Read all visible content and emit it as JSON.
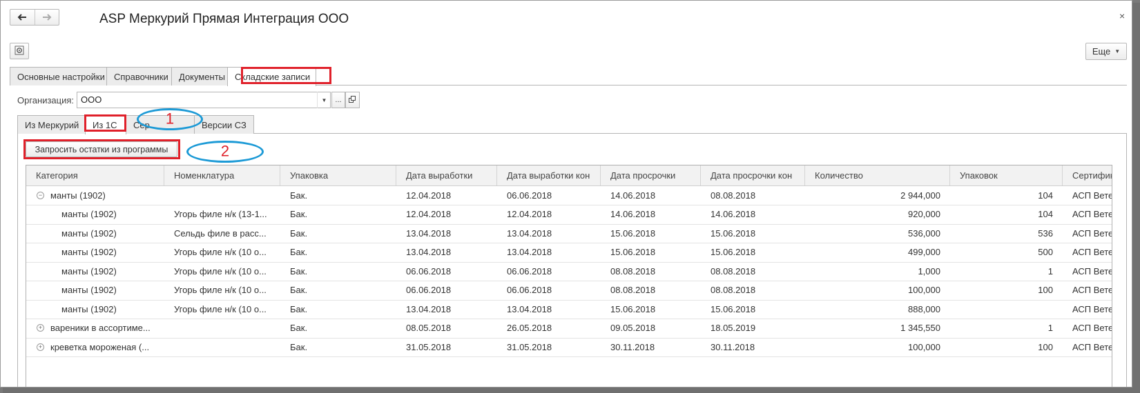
{
  "window": {
    "title": "ASP Меркурий Прямая Интеграция ООО",
    "close_symbol": "×"
  },
  "toolbar": {
    "more_label": "Еще"
  },
  "top_tabs": [
    {
      "label": "Основные настройки"
    },
    {
      "label": "Справочники"
    },
    {
      "label": "Документы"
    },
    {
      "label": "Складские записи"
    }
  ],
  "organization": {
    "label": "Организация:",
    "value": "ООО",
    "select_label": "..."
  },
  "inner_tabs": [
    {
      "label": "Из Меркурий"
    },
    {
      "label": "Из 1С"
    },
    {
      "label": "Сер"
    },
    {
      "label": "Версии СЗ"
    }
  ],
  "request_button_label": "Запросить остатки из программы",
  "callouts": {
    "one": "1",
    "two": "2"
  },
  "table": {
    "headers": [
      "Категория",
      "Номенклатура",
      "Упаковка",
      "Дата выработки",
      "Дата выработки кон",
      "Дата просрочки",
      "Дата просрочки кон",
      "Количество",
      "Упаковок",
      "Сертифик"
    ],
    "rows": [
      {
        "toggle": "⊖",
        "level": 0,
        "cells": [
          "манты (1902)",
          "",
          "Бак.",
          "12.04.2018",
          "06.06.2018",
          "14.06.2018",
          "08.08.2018",
          "2 944,000",
          "104",
          "АСП Вете"
        ]
      },
      {
        "toggle": "",
        "level": 1,
        "cells": [
          "манты (1902)",
          "Угорь филе н/к (13-1...",
          "Бак.",
          "12.04.2018",
          "12.04.2018",
          "14.06.2018",
          "14.06.2018",
          "920,000",
          "104",
          "АСП Вете"
        ]
      },
      {
        "toggle": "",
        "level": 1,
        "cells": [
          "манты (1902)",
          "Сельдь филе в расс...",
          "Бак.",
          "13.04.2018",
          "13.04.2018",
          "15.06.2018",
          "15.06.2018",
          "536,000",
          "536",
          "АСП Вете"
        ]
      },
      {
        "toggle": "",
        "level": 1,
        "cells": [
          "манты (1902)",
          "Угорь филе н/к (10 о...",
          "Бак.",
          "13.04.2018",
          "13.04.2018",
          "15.06.2018",
          "15.06.2018",
          "499,000",
          "500",
          "АСП Вете"
        ]
      },
      {
        "toggle": "",
        "level": 1,
        "cells": [
          "манты (1902)",
          "Угорь филе н/к (10 о...",
          "Бак.",
          "06.06.2018",
          "06.06.2018",
          "08.08.2018",
          "08.08.2018",
          "1,000",
          "1",
          "АСП Вете"
        ]
      },
      {
        "toggle": "",
        "level": 1,
        "cells": [
          "манты (1902)",
          "Угорь филе н/к (10 о...",
          "Бак.",
          "06.06.2018",
          "06.06.2018",
          "08.08.2018",
          "08.08.2018",
          "100,000",
          "100",
          "АСП Вете"
        ]
      },
      {
        "toggle": "",
        "level": 1,
        "cells": [
          "манты (1902)",
          "Угорь филе н/к (10 о...",
          "Бак.",
          "13.04.2018",
          "13.04.2018",
          "15.06.2018",
          "15.06.2018",
          "888,000",
          "",
          "АСП Вете"
        ]
      },
      {
        "toggle": "⊕",
        "level": 0,
        "cells": [
          "вареники в ассортиме...",
          "",
          "Бак.",
          "08.05.2018",
          "26.05.2018",
          "09.05.2018",
          "18.05.2019",
          "1 345,550",
          "1",
          "АСП Вете"
        ]
      },
      {
        "toggle": "⊕",
        "level": 0,
        "cells": [
          "креветка мороженая (...",
          "",
          "Бак.",
          "31.05.2018",
          "31.05.2018",
          "30.11.2018",
          "30.11.2018",
          "100,000",
          "100",
          "АСП Вете"
        ]
      }
    ]
  }
}
